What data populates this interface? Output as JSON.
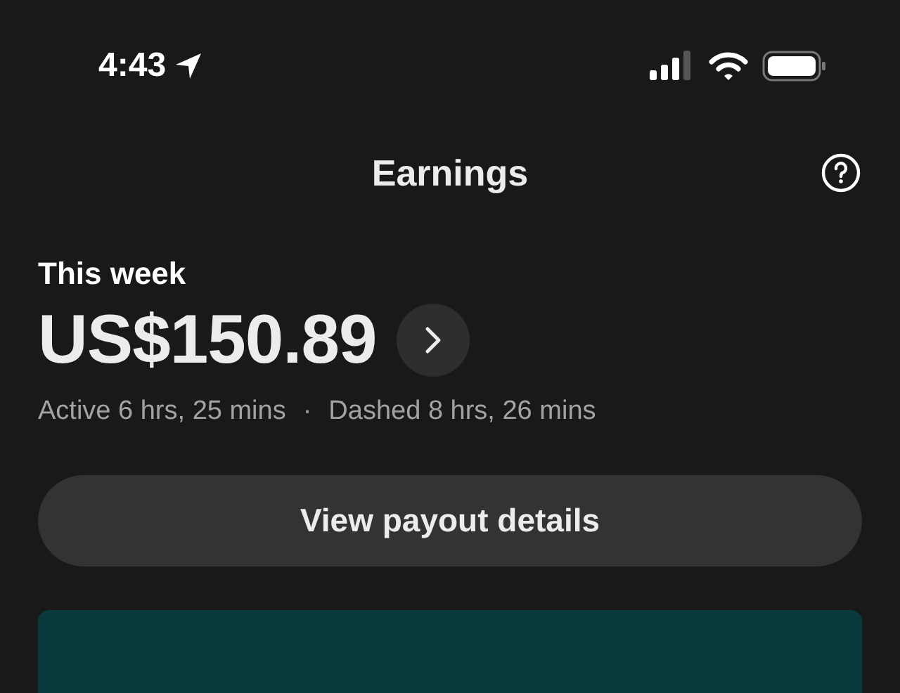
{
  "status_bar": {
    "time": "4:43"
  },
  "header": {
    "title": "Earnings"
  },
  "summary": {
    "label": "This week",
    "amount": "US$150.89",
    "active": "Active 6 hrs, 25 mins",
    "separator": "·",
    "dashed": "Dashed 8 hrs, 26 mins"
  },
  "buttons": [
    "View payout details"
  ]
}
